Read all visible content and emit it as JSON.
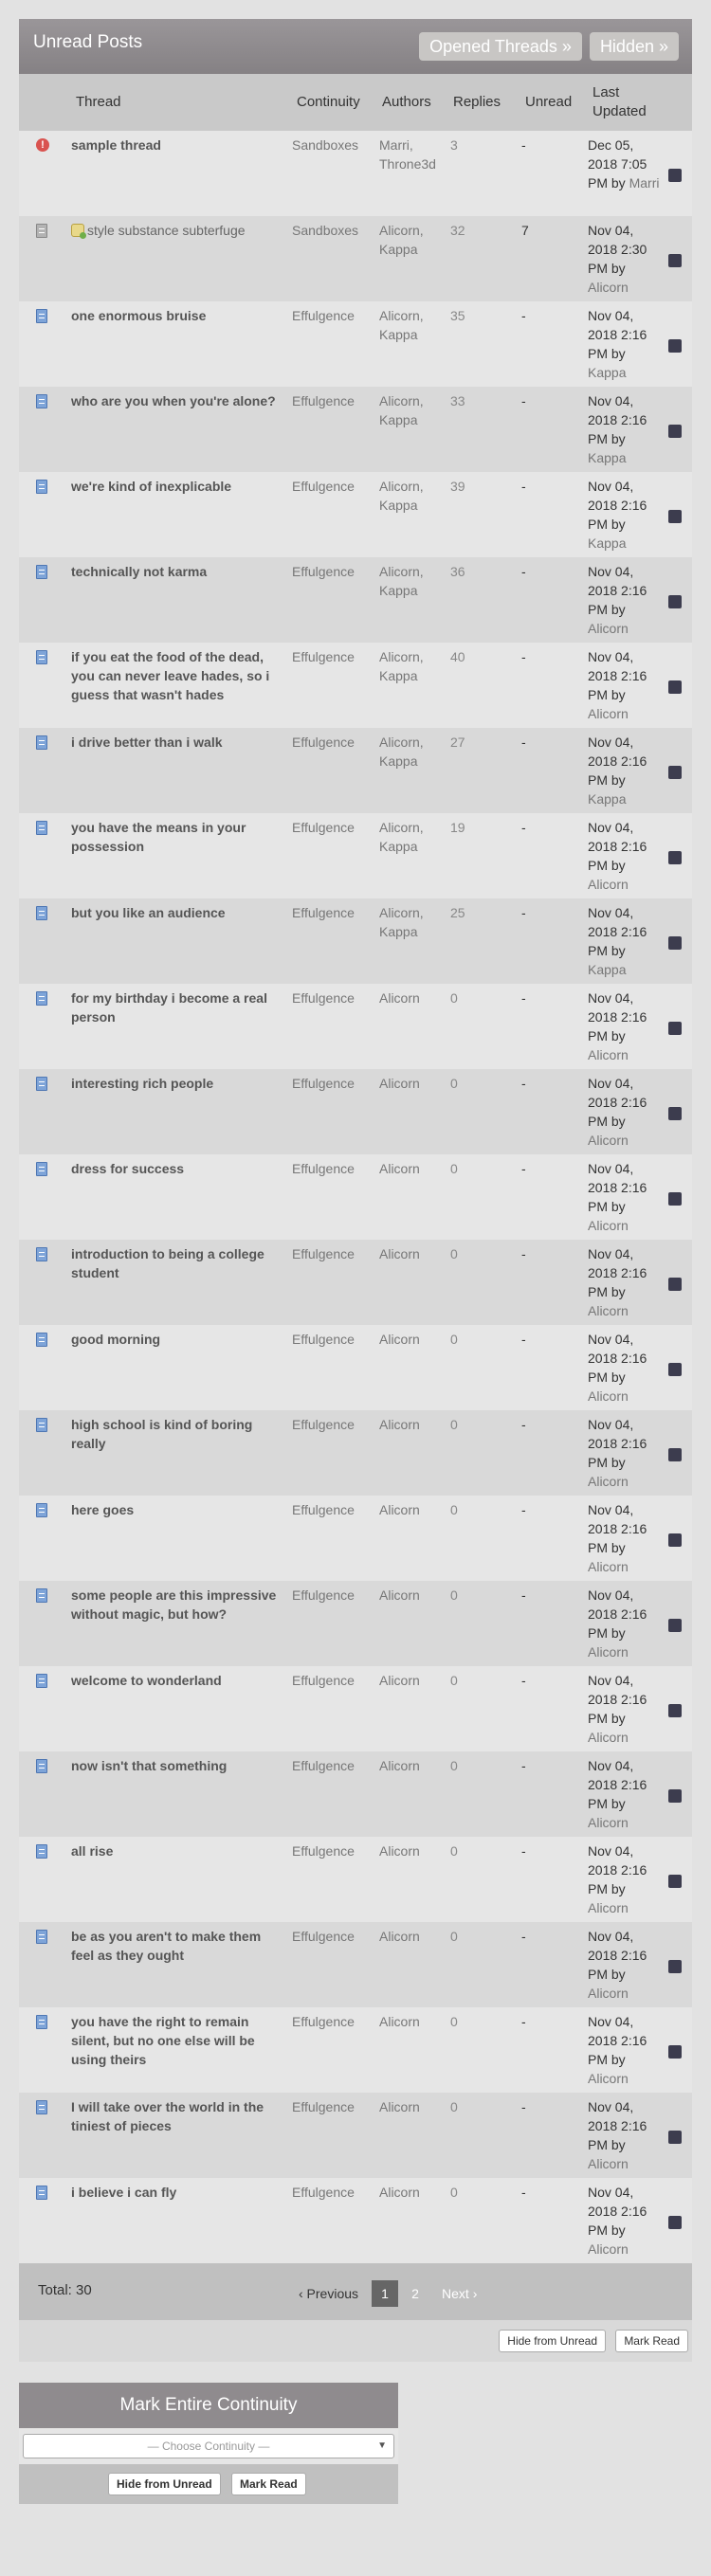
{
  "header": {
    "title": "Unread Posts",
    "opened_threads": "Opened Threads »",
    "hidden": "Hidden »"
  },
  "columns": [
    "Thread",
    "Continuity",
    "Authors",
    "Replies",
    "Unread",
    "Last Updated"
  ],
  "rows": [
    {
      "icon": "alert-icon",
      "thread": "sample thread",
      "continuity": "Sandboxes",
      "authors": [
        "Marri",
        "Throne3d"
      ],
      "replies": "3",
      "unread": "-",
      "date": "Dec 05, 2018 7:05 PM by",
      "by": "Marri"
    },
    {
      "icon": "grey-doc-icon",
      "thread": "style substance subterfuge",
      "continuity": "Sandboxes",
      "authors": [
        "Alicorn",
        "Kappa"
      ],
      "replies": "32",
      "unread": "7",
      "date": "Nov 04, 2018 2:30 PM by",
      "by": "Alicorn"
    },
    {
      "icon": "doc-icon",
      "thread": "one enormous bruise",
      "continuity": "Effulgence",
      "authors": [
        "Alicorn",
        "Kappa"
      ],
      "replies": "35",
      "unread": "-",
      "date": "Nov 04, 2018 2:16 PM by",
      "by": "Kappa"
    },
    {
      "icon": "doc-icon",
      "thread": "who are you when you're alone?",
      "continuity": "Effulgence",
      "authors": [
        "Alicorn",
        "Kappa"
      ],
      "replies": "33",
      "unread": "-",
      "date": "Nov 04, 2018 2:16 PM by",
      "by": "Kappa"
    },
    {
      "icon": "doc-icon",
      "thread": "we're kind of inexplicable",
      "continuity": "Effulgence",
      "authors": [
        "Alicorn",
        "Kappa"
      ],
      "replies": "39",
      "unread": "-",
      "date": "Nov 04, 2018 2:16 PM by",
      "by": "Kappa"
    },
    {
      "icon": "doc-icon",
      "thread": "technically not karma",
      "continuity": "Effulgence",
      "authors": [
        "Alicorn",
        "Kappa"
      ],
      "replies": "36",
      "unread": "-",
      "date": "Nov 04, 2018 2:16 PM by",
      "by": "Alicorn"
    },
    {
      "icon": "doc-icon",
      "thread": "if you eat the food of the dead, you can never leave hades, so i guess that wasn't hades",
      "continuity": "Effulgence",
      "authors": [
        "Alicorn",
        "Kappa"
      ],
      "replies": "40",
      "unread": "-",
      "date": "Nov 04, 2018 2:16 PM by",
      "by": "Alicorn"
    },
    {
      "icon": "doc-icon",
      "thread": "i drive better than i walk",
      "continuity": "Effulgence",
      "authors": [
        "Alicorn",
        "Kappa"
      ],
      "replies": "27",
      "unread": "-",
      "date": "Nov 04, 2018 2:16 PM by",
      "by": "Kappa"
    },
    {
      "icon": "doc-icon",
      "thread": "you have the means in your possession",
      "continuity": "Effulgence",
      "authors": [
        "Alicorn",
        "Kappa"
      ],
      "replies": "19",
      "unread": "-",
      "date": "Nov 04, 2018 2:16 PM by",
      "by": "Alicorn"
    },
    {
      "icon": "doc-icon",
      "thread": "but you like an audience",
      "continuity": "Effulgence",
      "authors": [
        "Alicorn",
        "Kappa"
      ],
      "replies": "25",
      "unread": "-",
      "date": "Nov 04, 2018 2:16 PM by",
      "by": "Kappa"
    },
    {
      "icon": "doc-icon",
      "thread": "for my birthday i become a real person",
      "continuity": "Effulgence",
      "authors": [
        "Alicorn"
      ],
      "replies": "0",
      "unread": "-",
      "date": "Nov 04, 2018 2:16 PM by",
      "by": "Alicorn"
    },
    {
      "icon": "doc-icon",
      "thread": "interesting rich people",
      "continuity": "Effulgence",
      "authors": [
        "Alicorn"
      ],
      "replies": "0",
      "unread": "-",
      "date": "Nov 04, 2018 2:16 PM by",
      "by": "Alicorn"
    },
    {
      "icon": "doc-icon",
      "thread": "dress for success",
      "continuity": "Effulgence",
      "authors": [
        "Alicorn"
      ],
      "replies": "0",
      "unread": "-",
      "date": "Nov 04, 2018 2:16 PM by",
      "by": "Alicorn"
    },
    {
      "icon": "doc-icon",
      "thread": "introduction to being a college student",
      "continuity": "Effulgence",
      "authors": [
        "Alicorn"
      ],
      "replies": "0",
      "unread": "-",
      "date": "Nov 04, 2018 2:16 PM by",
      "by": "Alicorn"
    },
    {
      "icon": "doc-icon",
      "thread": "good morning",
      "continuity": "Effulgence",
      "authors": [
        "Alicorn"
      ],
      "replies": "0",
      "unread": "-",
      "date": "Nov 04, 2018 2:16 PM by",
      "by": "Alicorn"
    },
    {
      "icon": "doc-icon",
      "thread": "high school is kind of boring really",
      "continuity": "Effulgence",
      "authors": [
        "Alicorn"
      ],
      "replies": "0",
      "unread": "-",
      "date": "Nov 04, 2018 2:16 PM by",
      "by": "Alicorn"
    },
    {
      "icon": "doc-icon",
      "thread": "here goes",
      "continuity": "Effulgence",
      "authors": [
        "Alicorn"
      ],
      "replies": "0",
      "unread": "-",
      "date": "Nov 04, 2018 2:16 PM by",
      "by": "Alicorn"
    },
    {
      "icon": "doc-icon",
      "thread": "some people are this impressive without magic, but how?",
      "continuity": "Effulgence",
      "authors": [
        "Alicorn"
      ],
      "replies": "0",
      "unread": "-",
      "date": "Nov 04, 2018 2:16 PM by",
      "by": "Alicorn"
    },
    {
      "icon": "doc-icon",
      "thread": "welcome to wonderland",
      "continuity": "Effulgence",
      "authors": [
        "Alicorn"
      ],
      "replies": "0",
      "unread": "-",
      "date": "Nov 04, 2018 2:16 PM by",
      "by": "Alicorn"
    },
    {
      "icon": "doc-icon",
      "thread": "now isn't that something",
      "continuity": "Effulgence",
      "authors": [
        "Alicorn"
      ],
      "replies": "0",
      "unread": "-",
      "date": "Nov 04, 2018 2:16 PM by",
      "by": "Alicorn"
    },
    {
      "icon": "doc-icon",
      "thread": "all rise",
      "continuity": "Effulgence",
      "authors": [
        "Alicorn"
      ],
      "replies": "0",
      "unread": "-",
      "date": "Nov 04, 2018 2:16 PM by",
      "by": "Alicorn"
    },
    {
      "icon": "doc-icon",
      "thread": "be as you aren't to make them feel as they ought",
      "continuity": "Effulgence",
      "authors": [
        "Alicorn"
      ],
      "replies": "0",
      "unread": "-",
      "date": "Nov 04, 2018 2:16 PM by",
      "by": "Alicorn"
    },
    {
      "icon": "doc-icon",
      "thread": "you have the right to remain silent, but no one else will be using theirs",
      "continuity": "Effulgence",
      "authors": [
        "Alicorn"
      ],
      "replies": "0",
      "unread": "-",
      "date": "Nov 04, 2018 2:16 PM by",
      "by": "Alicorn"
    },
    {
      "icon": "doc-icon",
      "thread": "I will take over the world in the tiniest of pieces",
      "continuity": "Effulgence",
      "authors": [
        "Alicorn"
      ],
      "replies": "0",
      "unread": "-",
      "date": "Nov 04, 2018 2:16 PM by",
      "by": "Alicorn"
    },
    {
      "icon": "doc-icon",
      "thread": "i believe i can fly",
      "continuity": "Effulgence",
      "authors": [
        "Alicorn"
      ],
      "replies": "0",
      "unread": "-",
      "date": "Nov 04, 2018 2:16 PM by",
      "by": "Alicorn"
    }
  ],
  "footer": {
    "total": "Total: 30",
    "prev": "‹ Previous",
    "pages": [
      "1",
      "2"
    ],
    "next": "Next ›"
  },
  "actions": {
    "hide_from_unread": "Hide from Unread",
    "mark_read": "Mark Read"
  },
  "mark_continuity": {
    "title": "Mark Entire Continuity",
    "select_placeholder": "— Choose Continuity —",
    "hide_from_unread": "Hide from Unread",
    "mark_read": "Mark Read"
  }
}
